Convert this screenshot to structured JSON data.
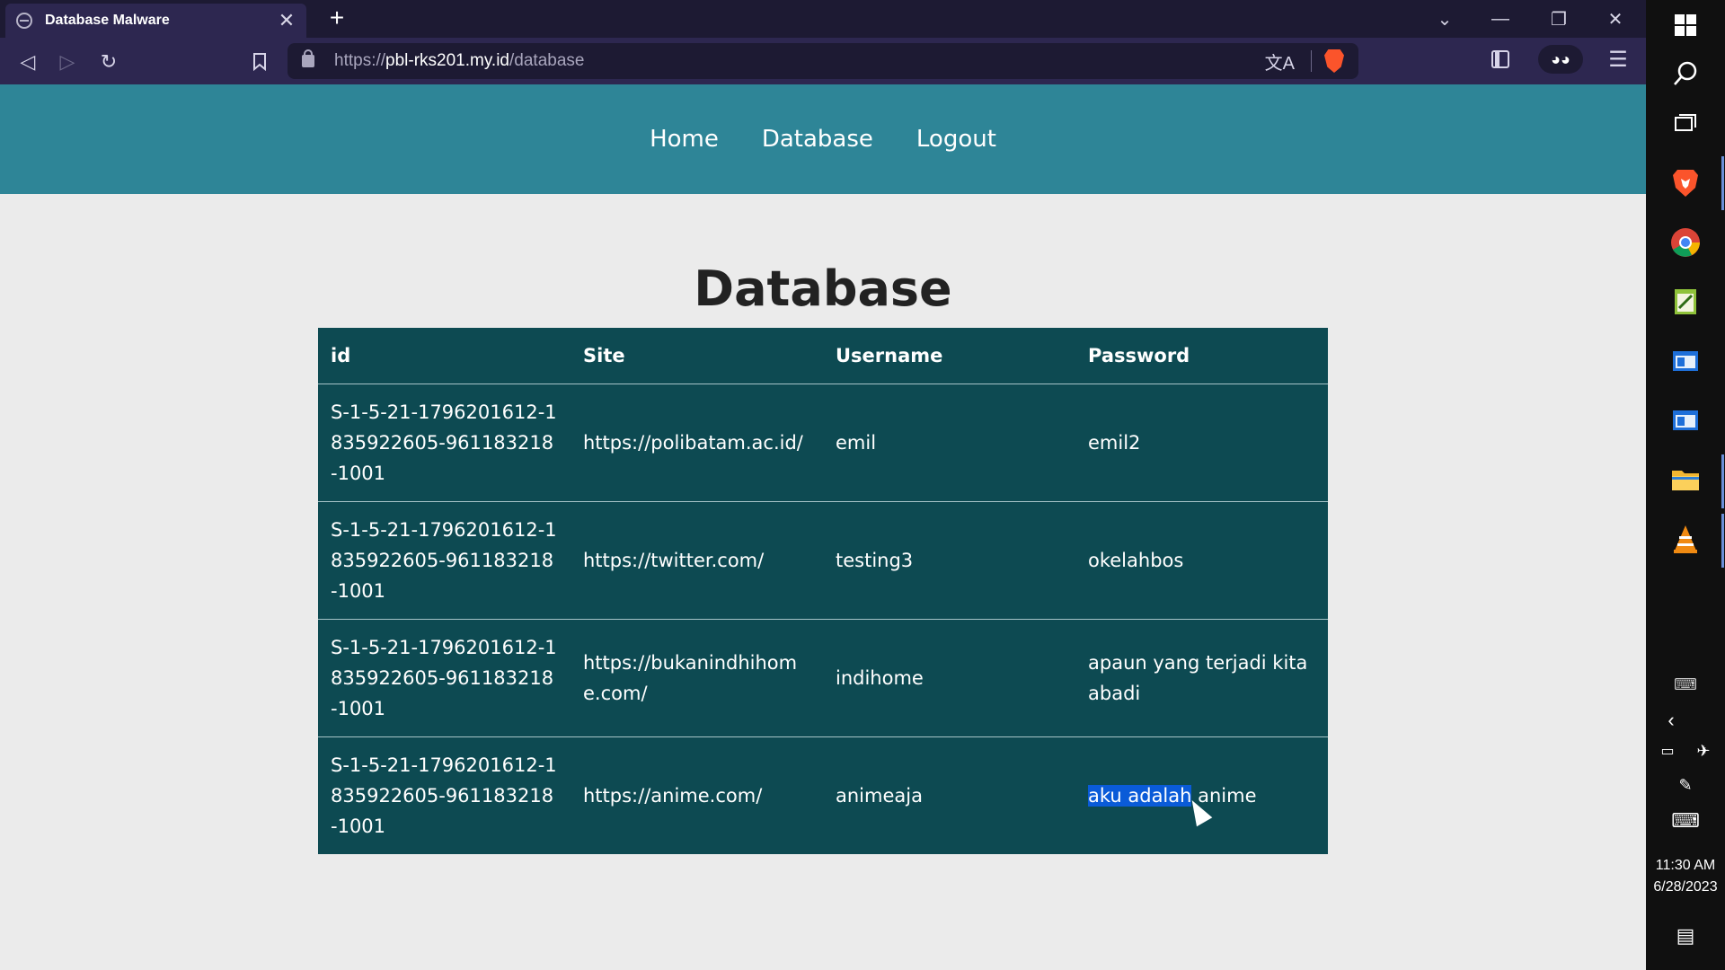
{
  "browser": {
    "tab_title": "Database Malware",
    "tab_close": "✕",
    "new_tab": "+",
    "window_controls": {
      "tabs_dropdown": "⌄",
      "minimize": "—",
      "restore": "❐",
      "close": "✕"
    },
    "url_prefix": "https://",
    "url_host": "pbl-rks201.my.id",
    "url_path": "/database",
    "translate_icon": "文A"
  },
  "site_nav": {
    "items": [
      "Home",
      "Database",
      "Logout"
    ]
  },
  "main": {
    "title": "Database",
    "table": {
      "headers": [
        "id",
        "Site",
        "Username",
        "Password"
      ],
      "rows": [
        {
          "id": "S-1-5-21-1796201612-1835922605-961183218-1001",
          "site": "https://polibatam.ac.id/",
          "username": "emil",
          "password": "emil2"
        },
        {
          "id": "S-1-5-21-1796201612-1835922605-961183218-1001",
          "site": "https://twitter.com/",
          "username": "testing3",
          "password": "okelahbos"
        },
        {
          "id": "S-1-5-21-1796201612-1835922605-961183218-1001",
          "site": "https://bukanindhihome.com/",
          "username": "indihome",
          "password": "apaun yang terjadi kita abadi"
        },
        {
          "id": "S-1-5-21-1796201612-1835922605-961183218-1001",
          "site": "https://anime.com/",
          "username": "animeaja",
          "password_selected": "aku adalah",
          "password_rest": " anime"
        }
      ]
    }
  },
  "taskbar": {
    "time": "11:30 AM",
    "date": "6/28/2023"
  },
  "colors": {
    "nav_bg": "#2e8597",
    "table_bg": "#0d4a52",
    "page_bg": "#ebebeb",
    "browser_bg": "#2d2750",
    "selection": "#0a5bd8"
  }
}
